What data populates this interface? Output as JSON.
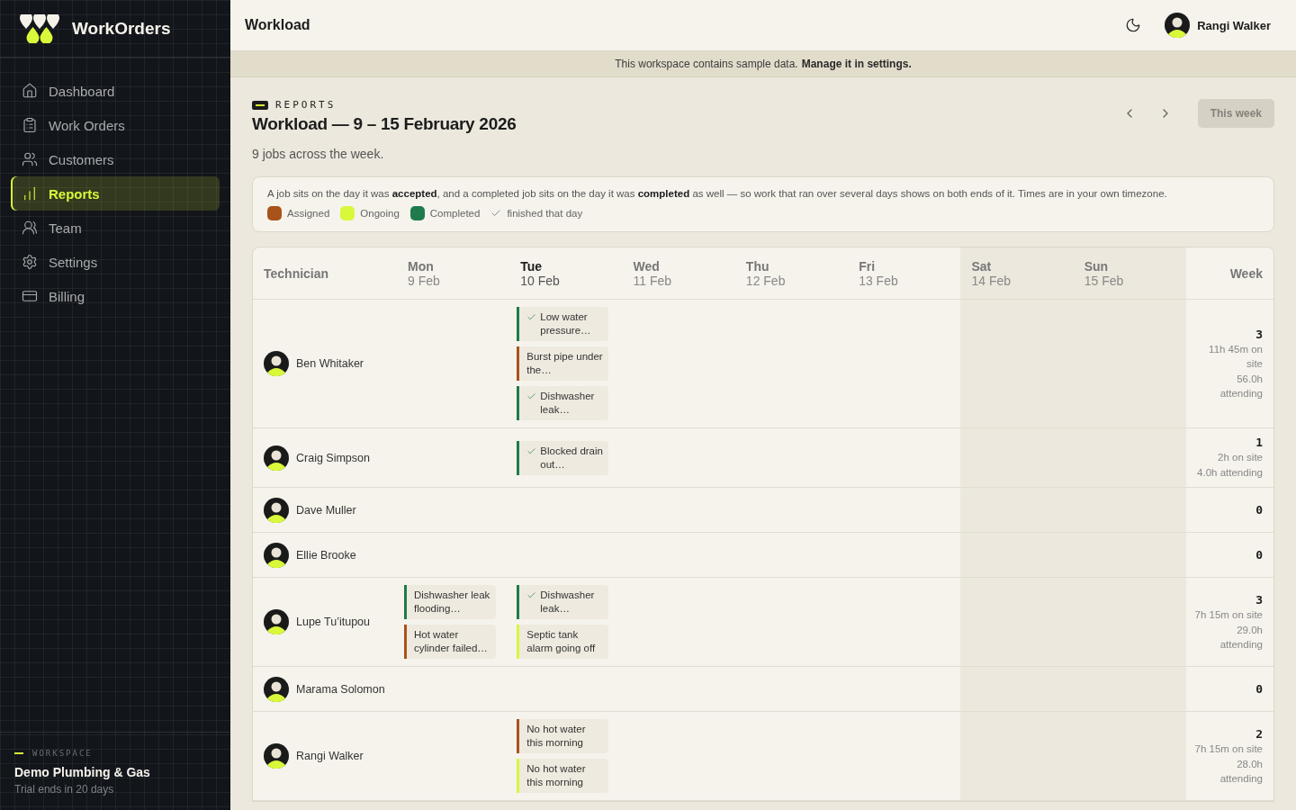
{
  "brand": {
    "name": "WorkOrders"
  },
  "sidebar": {
    "items": [
      {
        "label": "Dashboard",
        "selected": false
      },
      {
        "label": "Work Orders",
        "selected": false
      },
      {
        "label": "Customers",
        "selected": false
      },
      {
        "label": "Reports",
        "selected": true
      },
      {
        "label": "Team",
        "selected": false
      },
      {
        "label": "Settings",
        "selected": false
      },
      {
        "label": "Billing",
        "selected": false
      }
    ],
    "workspace": {
      "label": "WORKSPACE",
      "name": "Demo Plumbing & Gas",
      "trial": "Trial ends in 20 days"
    }
  },
  "topbar": {
    "title": "Workload",
    "user": "Rangi Walker"
  },
  "banner": {
    "text": "This workspace contains sample data.",
    "link": "Manage it in settings."
  },
  "header": {
    "eyebrow": "REPORTS",
    "title": "Workload — 9 – 15 February 2026",
    "subtitle": "9 jobs across the week.",
    "this_week": {
      "label": "This week",
      "disabled": true
    }
  },
  "note": {
    "text": "A job sits on the day it was **accepted**, and a completed job sits on the day it was **completed** as well — so work that ran over several days shows on both ends of it. Times are in your own timezone.",
    "legend": [
      {
        "label": "Assigned",
        "color": "#a9531a"
      },
      {
        "label": "Ongoing",
        "color": "#d9f83a"
      },
      {
        "label": "Completed",
        "color": "#1f7a4c"
      }
    ],
    "finished_label": "finished that day"
  },
  "table": {
    "technician_heading": "Technician",
    "week_heading": "Week",
    "days": [
      {
        "day": "Mon",
        "date": "9 Feb",
        "today": false,
        "weekend": false
      },
      {
        "day": "Tue",
        "date": "10 Feb",
        "today": true,
        "weekend": false
      },
      {
        "day": "Wed",
        "date": "11 Feb",
        "today": false,
        "weekend": false
      },
      {
        "day": "Thu",
        "date": "12 Feb",
        "today": false,
        "weekend": false
      },
      {
        "day": "Fri",
        "date": "13 Feb",
        "today": false,
        "weekend": false
      },
      {
        "day": "Sat",
        "date": "14 Feb",
        "today": false,
        "weekend": true
      },
      {
        "day": "Sun",
        "date": "15 Feb",
        "today": false,
        "weekend": true
      }
    ],
    "rows": [
      {
        "name": "Ben Whitaker",
        "count": "3",
        "on_site": "11h 45m on site",
        "attending": "56.0h attending",
        "tue": [
          {
            "title": "Low water pressure…",
            "kind": "completed",
            "finished": true
          },
          {
            "title": "Burst pipe under the…",
            "kind": "assigned",
            "finished": false
          },
          {
            "title": "Dishwasher leak…",
            "kind": "completed",
            "finished": true
          }
        ]
      },
      {
        "name": "Craig Simpson",
        "count": "1",
        "on_site": "2h on site",
        "attending": "4.0h attending",
        "tue": [
          {
            "title": "Blocked drain out…",
            "kind": "completed",
            "finished": true
          }
        ]
      },
      {
        "name": "Dave Muller",
        "count": "0"
      },
      {
        "name": "Ellie Brooke",
        "count": "0"
      },
      {
        "name": "Lupe Tu’itupou",
        "count": "3",
        "on_site": "7h 15m on site",
        "attending": "29.0h attending",
        "mon": [
          {
            "title": "Dishwasher leak flooding…",
            "kind": "completed",
            "finished": false
          },
          {
            "title": "Hot water cylinder failed…",
            "kind": "assigned",
            "finished": false
          }
        ],
        "tue": [
          {
            "title": "Dishwasher leak…",
            "kind": "completed",
            "finished": true
          },
          {
            "title": "Septic tank alarm going off",
            "kind": "ongoing",
            "finished": false
          }
        ]
      },
      {
        "name": "Marama Solomon",
        "count": "0"
      },
      {
        "name": "Rangi Walker",
        "count": "2",
        "on_site": "7h 15m on site",
        "attending": "28.0h attending",
        "tue": [
          {
            "title": "No hot water this morning",
            "kind": "assigned",
            "finished": false
          },
          {
            "title": "No hot water this morning",
            "kind": "ongoing",
            "finished": false
          }
        ]
      }
    ]
  }
}
